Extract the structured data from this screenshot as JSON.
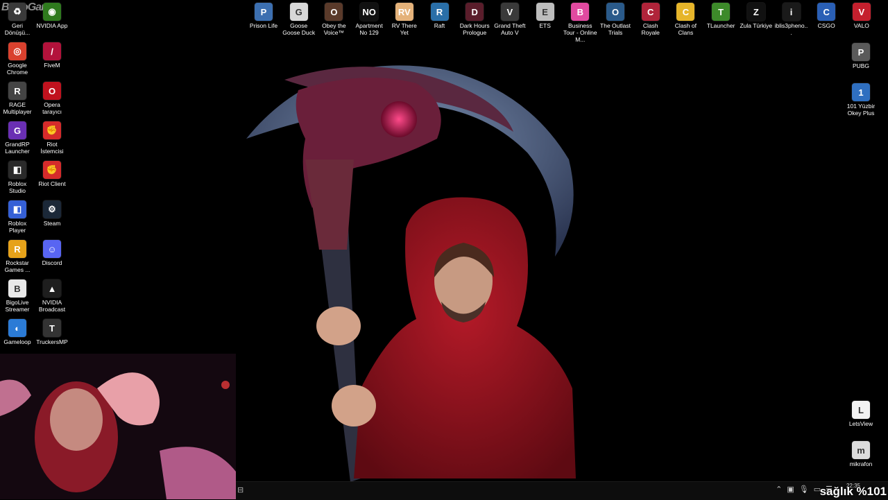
{
  "watermark": "ByNoGame",
  "left_icons": [
    {
      "label": "Geri Dönüşü...",
      "icon": "recycle-bin-icon",
      "color": "#3a3a3a",
      "glyph": "♻"
    },
    {
      "label": "NVIDIA App",
      "icon": "nvidia-icon",
      "color": "#2f7a1e",
      "glyph": "◉"
    },
    {
      "label": "Google Chrome",
      "icon": "chrome-icon",
      "color": "#d9412e",
      "glyph": "◎"
    },
    {
      "label": "FiveM",
      "icon": "fivem-icon",
      "color": "#b3123b",
      "glyph": "/"
    },
    {
      "label": "RAGE Multiplayer",
      "icon": "rage-icon",
      "color": "#444",
      "glyph": "R"
    },
    {
      "label": "Opera tarayıcı",
      "icon": "opera-icon",
      "color": "#c0121e",
      "glyph": "O"
    },
    {
      "label": "GrandRP Launcher",
      "icon": "grandrp-icon",
      "color": "#6a2fb3",
      "glyph": "G"
    },
    {
      "label": "Riot İstemcisi",
      "icon": "riot-icon",
      "color": "#d52b2b",
      "glyph": "✊"
    },
    {
      "label": "Roblox Studio",
      "icon": "roblox-studio-icon",
      "color": "#2a2a2a",
      "glyph": "◧"
    },
    {
      "label": "Riot Client",
      "icon": "riot-client-icon",
      "color": "#d52b2b",
      "glyph": "✊"
    },
    {
      "label": "Roblox Player",
      "icon": "roblox-player-icon",
      "color": "#3560d6",
      "glyph": "◧"
    },
    {
      "label": "Steam",
      "icon": "steam-icon",
      "color": "#1b2838",
      "glyph": "⚙"
    },
    {
      "label": "Rockstar Games ...",
      "icon": "rockstar-icon",
      "color": "#e6a21a",
      "glyph": "R"
    },
    {
      "label": "Discord",
      "icon": "discord-icon",
      "color": "#5865f2",
      "glyph": "☺"
    },
    {
      "label": "BigoLive Streamer",
      "icon": "bigolive-icon",
      "color": "#e8e8e8",
      "glyph": "B"
    },
    {
      "label": "NVIDIA Broadcast",
      "icon": "nvidia-broadcast-icon",
      "color": "#1e1e1e",
      "glyph": "▲"
    },
    {
      "label": "Gameloop",
      "icon": "gameloop-icon",
      "color": "#2b7bd6",
      "glyph": "◐"
    },
    {
      "label": "TruckersMP",
      "icon": "truckersmp-icon",
      "color": "#333",
      "glyph": "T"
    }
  ],
  "top_icons": [
    {
      "label": "Prison Life",
      "icon": "prison-life-icon",
      "color": "#3c6fb0",
      "glyph": "P"
    },
    {
      "label": "Goose Goose Duck",
      "icon": "goose-goose-duck-icon",
      "color": "#d8d8d8",
      "glyph": "G"
    },
    {
      "label": "Obey the Voice™",
      "icon": "obey-the-voice-icon",
      "color": "#5a3a2a",
      "glyph": "O"
    },
    {
      "label": "Apartment No 129",
      "icon": "apartment-icon",
      "color": "#111",
      "glyph": "NO"
    },
    {
      "label": "RV There Yet",
      "icon": "rv-there-yet-icon",
      "color": "#e4b27a",
      "glyph": "RV"
    },
    {
      "label": "Raft",
      "icon": "raft-icon",
      "color": "#2a6fa8",
      "glyph": "R"
    },
    {
      "label": "Dark Hours Prologue",
      "icon": "dark-hours-icon",
      "color": "#5a1d2b",
      "glyph": "D"
    },
    {
      "label": "Grand Theft Auto V",
      "icon": "gta-v-icon",
      "color": "#3a3a3a",
      "glyph": "V"
    },
    {
      "label": "ETS",
      "icon": "ets-icon",
      "color": "#bdbdbd",
      "glyph": "E"
    },
    {
      "label": "Business Tour - Online M...",
      "icon": "business-tour-icon",
      "color": "#e04aa0",
      "glyph": "B"
    },
    {
      "label": "The Outlast Trials",
      "icon": "outlast-trials-icon",
      "color": "#2a5a8a",
      "glyph": "O"
    },
    {
      "label": "Clash Royale",
      "icon": "clash-royale-icon",
      "color": "#b0243a",
      "glyph": "C"
    },
    {
      "label": "Clash of Clans",
      "icon": "clash-of-clans-icon",
      "color": "#e6b52a",
      "glyph": "C"
    },
    {
      "label": "TLauncher",
      "icon": "tlauncher-icon",
      "color": "#3d8a2a",
      "glyph": "T"
    },
    {
      "label": "Zula Türkiye",
      "icon": "zula-icon",
      "color": "#111",
      "glyph": "Z"
    },
    {
      "label": "iblis3pheno...",
      "icon": "iblis-icon",
      "color": "#1a1a1a",
      "glyph": "i"
    },
    {
      "label": "CSGO",
      "icon": "csgo-icon",
      "color": "#2a5fb5",
      "glyph": "C"
    },
    {
      "label": "VALO",
      "icon": "valorant-icon",
      "color": "#c5202e",
      "glyph": "V"
    }
  ],
  "right_icons": [
    {
      "label": "PUBG",
      "icon": "pubg-icon",
      "color": "#5a5a5a",
      "glyph": "P"
    },
    {
      "label": "101 Yüzbir Okey Plus",
      "icon": "okey-plus-icon",
      "color": "#2f6fc0",
      "glyph": "1"
    },
    {
      "label": "LetsView",
      "icon": "letsview-icon",
      "color": "#f2f2f2",
      "glyph": "L"
    },
    {
      "label": "mikrafon",
      "icon": "mikrafon-icon",
      "color": "#dcdcdc",
      "glyph": "m"
    }
  ],
  "taskbar": {
    "start_glyph": "⊟",
    "clock_time": "22:35",
    "clock_date": ""
  },
  "overlay": {
    "health_text": "sağlık %101"
  }
}
